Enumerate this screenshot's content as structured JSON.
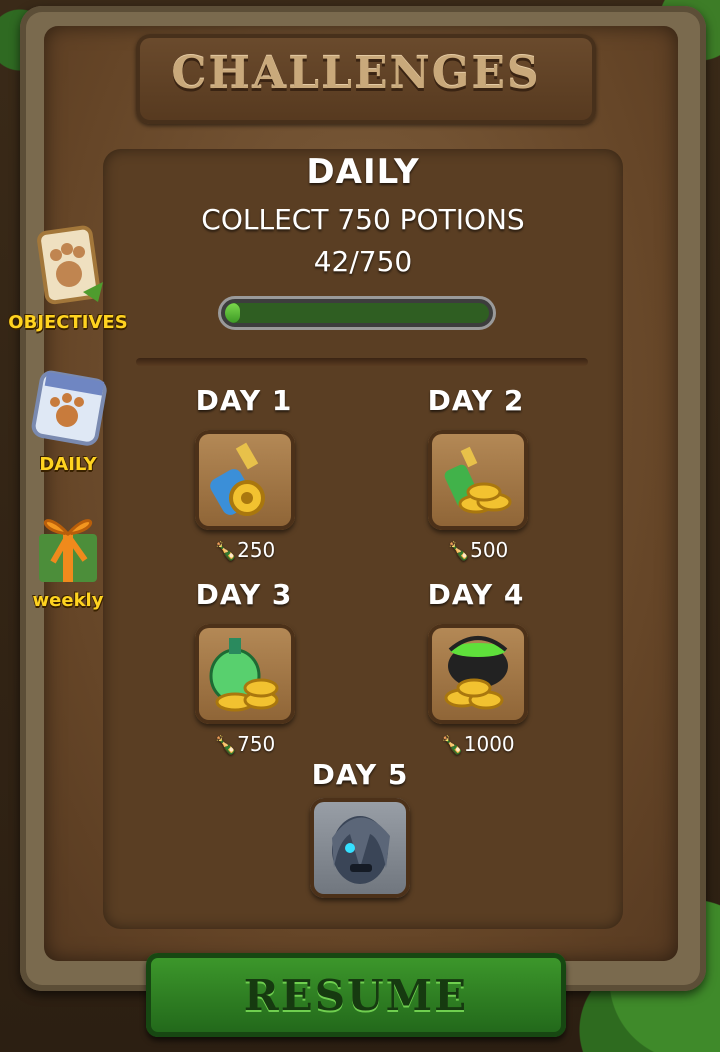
{
  "header": {
    "title": "CHALLENGES"
  },
  "sidebar": {
    "items": [
      {
        "label": "OBJECTIVES",
        "icon": "paw-scroll-icon"
      },
      {
        "label": "DAILY",
        "icon": "paw-calendar-icon"
      },
      {
        "label": "weekly",
        "icon": "gift-box-icon"
      }
    ]
  },
  "challenge": {
    "heading": "DAILY",
    "task": "COLLECT 750 POTIONS",
    "progress_text": "42/750",
    "progress_fraction": 0.056
  },
  "days": [
    {
      "label": "DAY 1",
      "reward_icon": "potion-coin-icon",
      "cost": "250"
    },
    {
      "label": "DAY 2",
      "reward_icon": "potion-coins-icon",
      "cost": "500"
    },
    {
      "label": "DAY 3",
      "reward_icon": "potion-bottle-coins-icon",
      "cost": "750"
    },
    {
      "label": "DAY 4",
      "reward_icon": "cauldron-coins-icon",
      "cost": "1000"
    },
    {
      "label": "DAY 5",
      "reward_icon": "zombie-character-icon"
    }
  ],
  "actions": {
    "resume_label": "RESUME"
  },
  "colors": {
    "accent_green": "#3e9a2c",
    "label_yellow": "#ffd320",
    "panel_brown": "#5a3e23"
  }
}
